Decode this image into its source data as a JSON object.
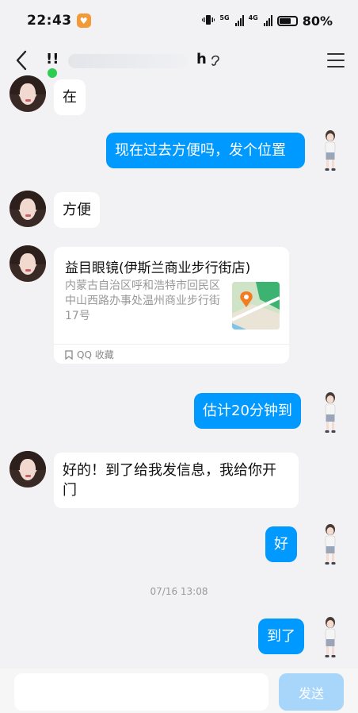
{
  "status_bar": {
    "time": "22:43",
    "network_1": "5G",
    "network_2": "4G",
    "battery_pct": "80%"
  },
  "header": {
    "title_prefix": "!!",
    "title_suffix": "h",
    "back_icon": "chevron-left-icon",
    "menu_icon": "hamburger-menu-icon",
    "ear_icon": "ear-icon"
  },
  "messages": {
    "m1": "在",
    "m2": "现在过去方便吗，发个位置",
    "m3": "方便",
    "m4": "估计20分钟到",
    "m5": "好的！到了给我发信息，我给你开门",
    "m6": "好",
    "m7": "到了"
  },
  "location_card": {
    "title": "益目眼镜(伊斯兰商业步行街店)",
    "address": "内蒙古自治区呼和浩特市回民区中山西路办事处温州商业步行街17号",
    "source": "QQ 收藏",
    "map_icon": "map-pin-icon",
    "bookmark_icon": "bookmark-icon"
  },
  "timestamp": "07/16 13:08",
  "input_bar": {
    "value": "",
    "send_label": "发送"
  },
  "colors": {
    "outgoing_bubble": "#0099ff",
    "incoming_bubble": "#ffffff",
    "background": "#f2f2f4",
    "online": "#2ecc51",
    "send_disabled": "#a8d6fb"
  }
}
